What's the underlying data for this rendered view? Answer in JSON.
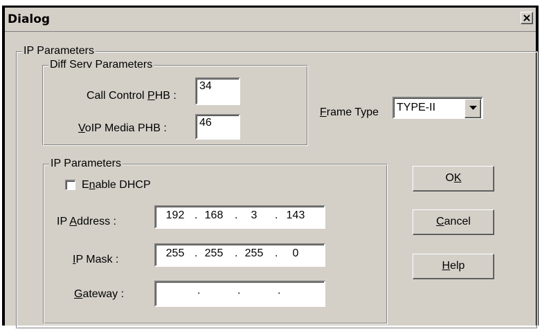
{
  "window": {
    "title": "Dialog"
  },
  "ip_parameters_outer": {
    "label": "IP Parameters"
  },
  "diffserv": {
    "label": "Diff Serv Parameters",
    "call_control_label_pre": "Call Control ",
    "call_control_label_mn": "P",
    "call_control_label_post": "HB :",
    "call_control_value": "34",
    "voip_label_mn": "V",
    "voip_label_post": "oIP Media PHB :",
    "voip_value": "46"
  },
  "frame_type": {
    "label_mn": "F",
    "label_post": "rame Type",
    "selected": "TYPE-II"
  },
  "ip_parameters_inner": {
    "label": "IP Parameters",
    "dhcp_pre": "E",
    "dhcp_mn": "n",
    "dhcp_post": "able DHCP",
    "dhcp_checked": false,
    "ip_address_pre": "IP ",
    "ip_address_mn": "A",
    "ip_address_post": "ddress :",
    "ip_address": [
      "192",
      "168",
      "3",
      "143"
    ],
    "ip_mask_mn": "I",
    "ip_mask_post": "P Mask :",
    "ip_mask": [
      "255",
      "255",
      "255",
      "0"
    ],
    "gateway_mn": "G",
    "gateway_post": "ateway :",
    "gateway": [
      "",
      "",
      "",
      ""
    ]
  },
  "buttons": {
    "ok_pre": "O",
    "ok_mn": "K",
    "cancel_mn": "C",
    "cancel_post": "ancel",
    "help_mn": "H",
    "help_post": "elp"
  },
  "icons": {
    "close": "close-icon",
    "dropdown": "chevron-down-icon",
    "checkbox": "checkbox-icon"
  },
  "colors": {
    "face": "#d4d0c8",
    "shadow": "#808080",
    "highlight": "#ffffff"
  }
}
